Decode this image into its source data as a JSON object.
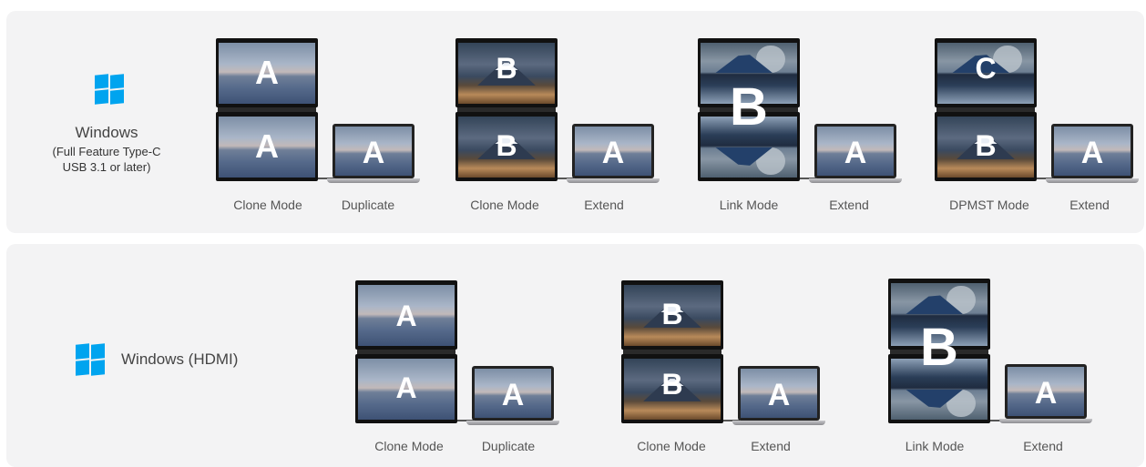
{
  "rows": [
    {
      "title": "Windows",
      "subtitle": [
        "(Full Feature Type-C",
        "USB 3.1 or later)"
      ],
      "icon": "windows-logo-icon",
      "groups": [
        {
          "top": "A",
          "bottom": "A",
          "laptop": "A",
          "mode": "Clone Mode",
          "laptop_mode": "Duplicate"
        },
        {
          "top": "B",
          "bottom": "B",
          "laptop": "A",
          "mode": "Clone Mode",
          "laptop_mode": "Extend"
        },
        {
          "top": "B",
          "bottom": "",
          "laptop": "A",
          "mode": "Link Mode",
          "laptop_mode": "Extend"
        },
        {
          "top": "C",
          "bottom": "B",
          "laptop": "A",
          "mode": "DPMST Mode",
          "laptop_mode": "Extend"
        }
      ]
    },
    {
      "title": "Windows (HDMI)",
      "icon": "windows-logo-icon",
      "groups": [
        {
          "top": "A",
          "bottom": "A",
          "laptop": "A",
          "mode": "Clone Mode",
          "laptop_mode": "Duplicate"
        },
        {
          "top": "B",
          "bottom": "B",
          "laptop": "A",
          "mode": "Clone Mode",
          "laptop_mode": "Extend"
        },
        {
          "top": "B",
          "bottom": "",
          "laptop": "A",
          "mode": "Link Mode",
          "laptop_mode": "Extend"
        }
      ]
    }
  ],
  "colors": {
    "accent": "#00a4ef",
    "panel": "#f3f3f4"
  }
}
